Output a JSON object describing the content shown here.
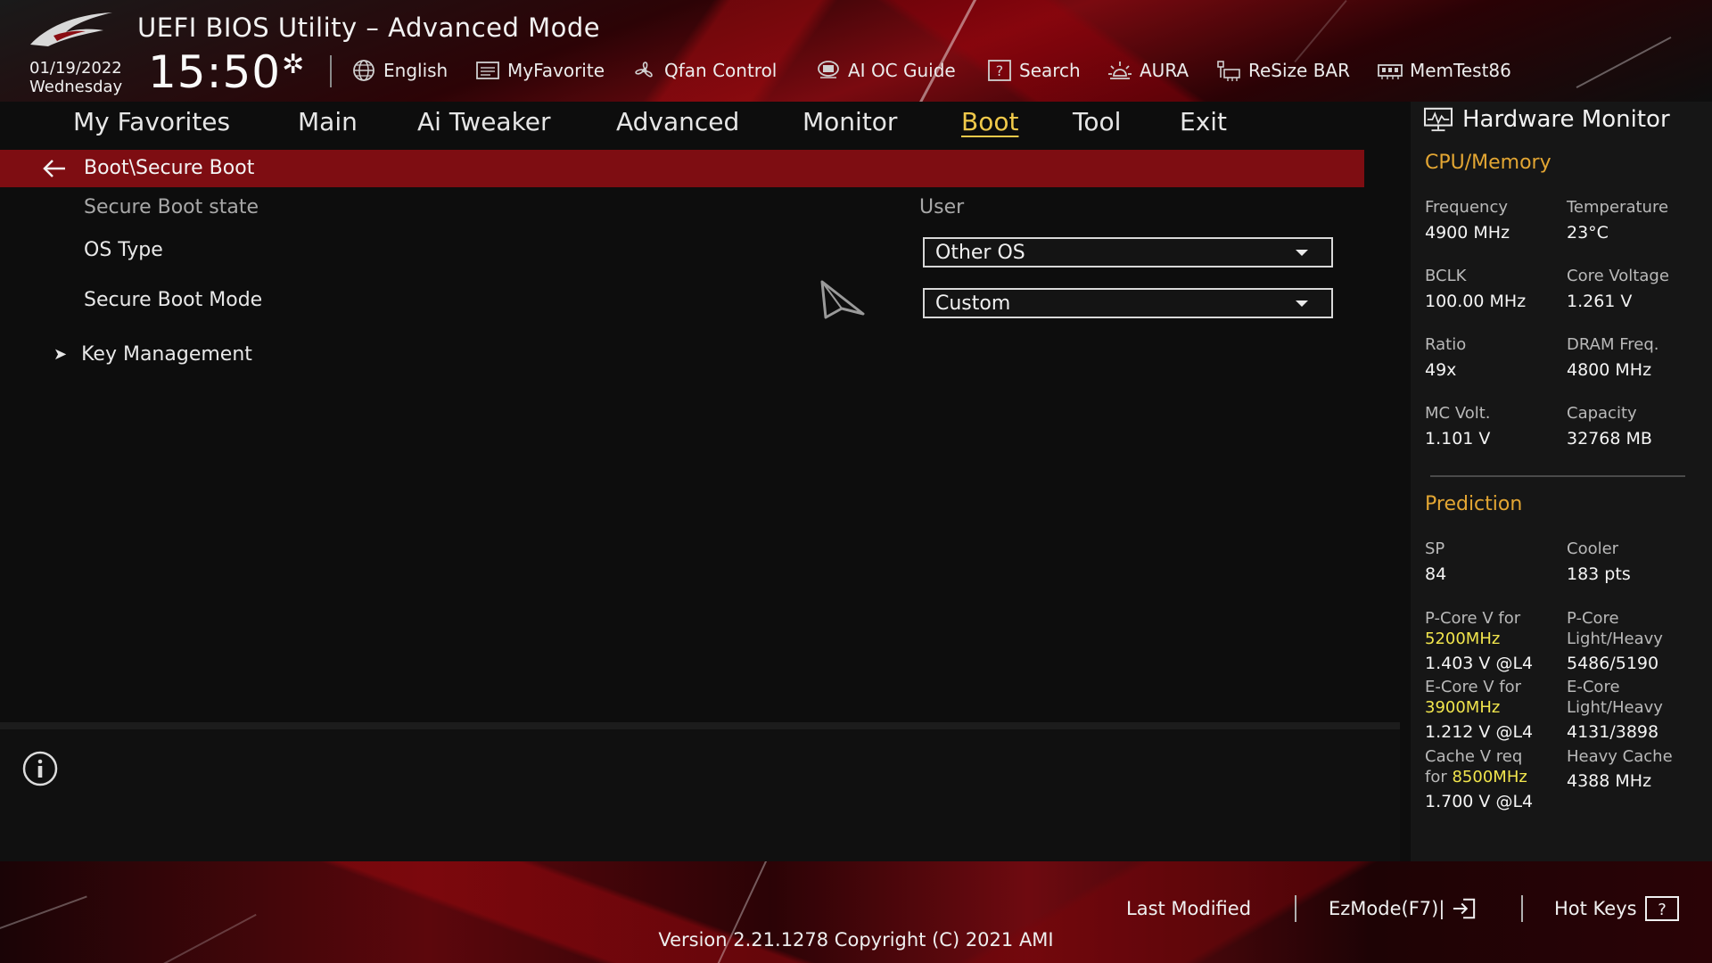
{
  "header": {
    "title": "UEFI BIOS Utility – Advanced Mode",
    "date": "01/19/2022",
    "weekday": "Wednesday",
    "time": "15:50",
    "toolbar": [
      {
        "label": "English",
        "icon": "globe-icon"
      },
      {
        "label": "MyFavorite",
        "icon": "favorite-icon"
      },
      {
        "label": "Qfan Control",
        "icon": "fan-icon"
      },
      {
        "label": "AI OC Guide",
        "icon": "ai-chip-icon"
      },
      {
        "label": "Search",
        "icon": "search-icon"
      },
      {
        "label": "AURA",
        "icon": "aura-icon"
      },
      {
        "label": "ReSize BAR",
        "icon": "resize-bar-icon"
      },
      {
        "label": "MemTest86",
        "icon": "memory-icon"
      }
    ]
  },
  "nav": {
    "tabs": [
      "My Favorites",
      "Main",
      "Ai Tweaker",
      "Advanced",
      "Monitor",
      "Boot",
      "Tool",
      "Exit"
    ],
    "active": "Boot"
  },
  "content": {
    "breadcrumb": "Boot\\Secure Boot",
    "secure_boot_state": {
      "label": "Secure Boot state",
      "value": "User"
    },
    "os_type": {
      "label": "OS Type",
      "value": "Other OS"
    },
    "secure_boot_mode": {
      "label": "Secure Boot Mode",
      "value": "Custom"
    },
    "key_management": {
      "label": "Key Management"
    }
  },
  "hardware_monitor": {
    "title": "Hardware Monitor",
    "cpu_memory": {
      "title": "CPU/Memory",
      "frequency": {
        "label": "Frequency",
        "value": "4900 MHz"
      },
      "temperature": {
        "label": "Temperature",
        "value": "23°C"
      },
      "bclk": {
        "label": "BCLK",
        "value": "100.00 MHz"
      },
      "core_voltage": {
        "label": "Core Voltage",
        "value": "1.261 V"
      },
      "ratio": {
        "label": "Ratio",
        "value": "49x"
      },
      "dram_freq": {
        "label": "DRAM Freq.",
        "value": "4800 MHz"
      },
      "mc_volt": {
        "label": "MC Volt.",
        "value": "1.101 V"
      },
      "capacity": {
        "label": "Capacity",
        "value": "32768 MB"
      }
    },
    "prediction": {
      "title": "Prediction",
      "sp": {
        "label": "SP",
        "value": "84"
      },
      "cooler": {
        "label": "Cooler",
        "value": "183 pts"
      },
      "pcore_v": {
        "label": "P-Core V for",
        "freq": "5200MHz",
        "value": "1.403 V @L4"
      },
      "pcore_lh": {
        "label1": "P-Core",
        "label2": "Light/Heavy",
        "value": "5486/5190"
      },
      "ecore_v": {
        "label": "E-Core V for",
        "freq": "3900MHz",
        "value": "1.212 V @L4"
      },
      "ecore_lh": {
        "label1": "E-Core",
        "label2": "Light/Heavy",
        "value": "4131/3898"
      },
      "cache_v": {
        "label1": "Cache V req",
        "label2_prefix": "for ",
        "freq": "8500MHz",
        "value": "1.700 V @L4"
      },
      "heavy_cache": {
        "label": "Heavy Cache",
        "value": "4388 MHz"
      }
    }
  },
  "footer": {
    "last_modified": "Last Modified",
    "ezmode": "EzMode(F7)|",
    "hot_keys": "Hot Keys",
    "version": "Version 2.21.1278 Copyright (C) 2021 AMI"
  },
  "colors": {
    "accent_red": "#7e0d12",
    "active_tab": "#f0c94a",
    "section_orange": "#e3a633",
    "highlight_yellow": "#f2e64d"
  }
}
